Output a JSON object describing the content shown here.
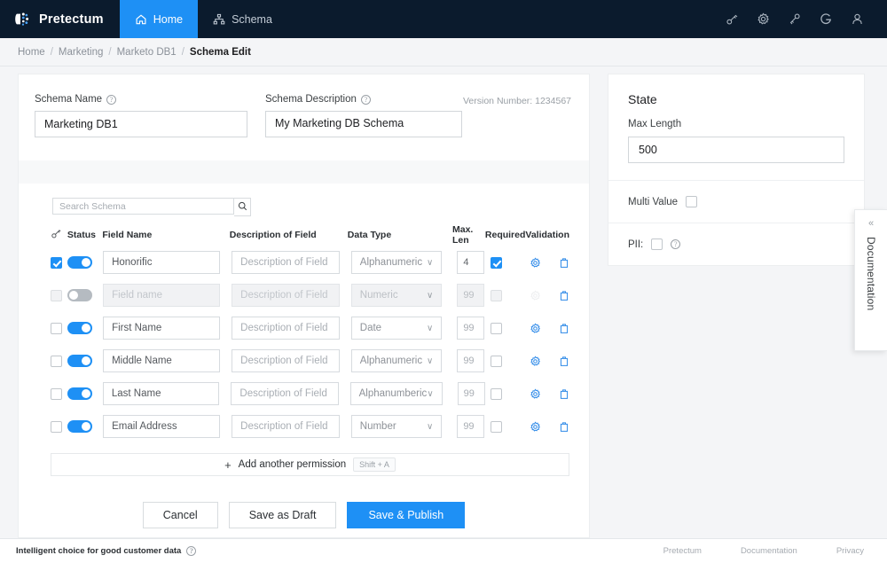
{
  "topnav": {
    "brand": "Pretectum",
    "items": [
      {
        "label": "Home",
        "icon": "home-icon",
        "active": true
      },
      {
        "label": "Schema",
        "icon": "sitemap-icon",
        "active": false
      }
    ],
    "right_icons": [
      "key-icon",
      "gear-icon",
      "key-icon",
      "google-icon",
      "user-icon"
    ],
    "accent": "#1e90f5",
    "background": "#0b1b2d"
  },
  "breadcrumb": {
    "items": [
      "Home",
      "Marketing",
      "Marketo DB1",
      "Schema Edit"
    ],
    "separator": "/"
  },
  "meta": {
    "schema_name_label": "Schema Name",
    "schema_name_value": "Marketing DB1",
    "schema_desc_label": "Schema Description",
    "schema_desc_value": "My Marketing DB Schema",
    "version_text": "Version Number: 1234567",
    "help_glyph": "?"
  },
  "search": {
    "placeholder": "Search Schema",
    "value": "",
    "icon": "search-icon"
  },
  "table": {
    "headers": {
      "key": "key-icon",
      "status": "Status",
      "field_name": "Field Name",
      "description": "Description of Field",
      "data_type": "Data Type",
      "max_len": "Max. Len",
      "required": "Required",
      "validation": "Validation"
    },
    "desc_placeholder": "Description of Field",
    "chevron": "∨",
    "rows": [
      {
        "key_checked": true,
        "enabled": true,
        "field_name": "Honorific",
        "field_placeholder": "",
        "data_type": "Alphanumeric",
        "max_len": "4",
        "required": true,
        "disabled": false
      },
      {
        "key_checked": false,
        "enabled": false,
        "field_name": "",
        "field_placeholder": "Field name",
        "data_type": "Numeric",
        "max_len": "99",
        "required": false,
        "disabled": true
      },
      {
        "key_checked": false,
        "enabled": true,
        "field_name": "First Name",
        "field_placeholder": "",
        "data_type": "Date",
        "max_len": "99",
        "required": false,
        "disabled": false
      },
      {
        "key_checked": false,
        "enabled": true,
        "field_name": "Middle Name",
        "field_placeholder": "",
        "data_type": "Alphanumeric",
        "max_len": "99",
        "required": false,
        "disabled": false
      },
      {
        "key_checked": false,
        "enabled": true,
        "field_name": "Last Name",
        "field_placeholder": "",
        "data_type": "Alphanumberic",
        "max_len": "99",
        "required": false,
        "disabled": false
      },
      {
        "key_checked": false,
        "enabled": true,
        "field_name": "Email Address",
        "field_placeholder": "",
        "data_type": "Number",
        "max_len": "99",
        "required": false,
        "disabled": false
      }
    ]
  },
  "add_row": {
    "plus": "+",
    "label": "Add another permission",
    "shortcut": "Shift + A"
  },
  "actions": {
    "cancel": "Cancel",
    "save_draft": "Save as Draft",
    "save_publish": "Save & Publish"
  },
  "state_panel": {
    "title": "State",
    "max_length_label": "Max  Length",
    "max_length_value": "500",
    "multi_value_label": "Multi Value",
    "multi_value_checked": false,
    "pii_label": "PII:",
    "pii_checked": false,
    "help_glyph": "?"
  },
  "doc_tab": {
    "label": "Documentation",
    "collapse_glyph": "«"
  },
  "footer": {
    "tagline": "Intelligent choice for good customer data",
    "help_glyph": "?",
    "links": [
      "Pretectum",
      "Documentation",
      "Privacy"
    ]
  }
}
